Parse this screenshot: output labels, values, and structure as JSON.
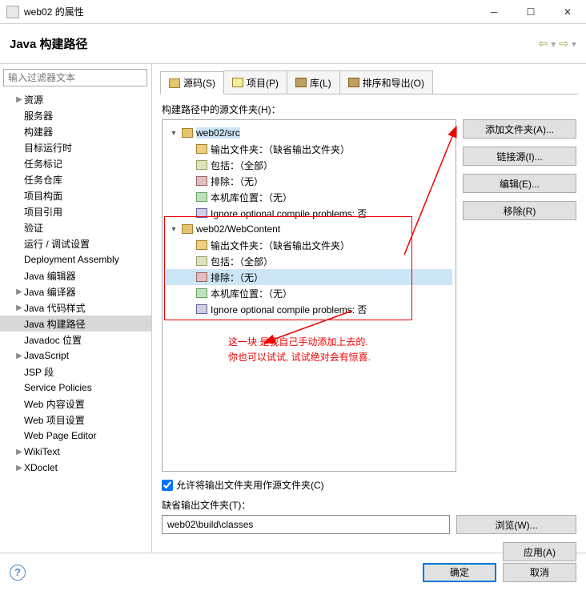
{
  "window": {
    "title": "web02 的属性"
  },
  "filter": {
    "placeholder": "输入过滤器文本"
  },
  "sidebar": {
    "items": [
      {
        "label": "资源",
        "expandable": true,
        "selected": false
      },
      {
        "label": "服务器",
        "expandable": false,
        "selected": false
      },
      {
        "label": "构建器",
        "expandable": false,
        "selected": false
      },
      {
        "label": "目标运行时",
        "expandable": false,
        "selected": false
      },
      {
        "label": "任务标记",
        "expandable": false,
        "selected": false
      },
      {
        "label": "任务仓库",
        "expandable": false,
        "selected": false
      },
      {
        "label": "项目构面",
        "expandable": false,
        "selected": false
      },
      {
        "label": "项目引用",
        "expandable": false,
        "selected": false
      },
      {
        "label": "验证",
        "expandable": false,
        "selected": false
      },
      {
        "label": "运行 / 调试设置",
        "expandable": false,
        "selected": false
      },
      {
        "label": "Deployment Assembly",
        "expandable": false,
        "selected": false
      },
      {
        "label": "Java 编辑器",
        "expandable": false,
        "selected": false
      },
      {
        "label": "Java 编译器",
        "expandable": true,
        "selected": false
      },
      {
        "label": "Java 代码样式",
        "expandable": true,
        "selected": false
      },
      {
        "label": "Java 构建路径",
        "expandable": false,
        "selected": true
      },
      {
        "label": "Javadoc 位置",
        "expandable": false,
        "selected": false
      },
      {
        "label": "JavaScript",
        "expandable": true,
        "selected": false
      },
      {
        "label": "JSP 段",
        "expandable": false,
        "selected": false
      },
      {
        "label": "Service Policies",
        "expandable": false,
        "selected": false
      },
      {
        "label": "Web 内容设置",
        "expandable": false,
        "selected": false
      },
      {
        "label": "Web 项目设置",
        "expandable": false,
        "selected": false
      },
      {
        "label": "Web Page Editor",
        "expandable": false,
        "selected": false
      },
      {
        "label": "WikiText",
        "expandable": true,
        "selected": false
      },
      {
        "label": "XDoclet",
        "expandable": true,
        "selected": false
      }
    ]
  },
  "page": {
    "heading": "Java 构建路径",
    "tabs": [
      {
        "label": "源码(S)",
        "iconClass": "ic-folder",
        "active": true
      },
      {
        "label": "项目(P)",
        "iconClass": "ic-proj",
        "active": false
      },
      {
        "label": "库(L)",
        "iconClass": "ic-lib",
        "active": false
      },
      {
        "label": "排序和导出(O)",
        "iconClass": "ic-order",
        "active": false
      }
    ],
    "sourceFoldersLabel": "构建路径中的源文件夹(H)：",
    "buttons": {
      "addFolder": "添加文件夹(A)...",
      "linkSource": "链接源(I)...",
      "edit": "编辑(E)...",
      "remove": "移除(R)"
    },
    "folders": [
      {
        "name": "web02/src",
        "children": [
          {
            "icon": "ic-out",
            "text": "输出文件夹：（缺省输出文件夹）"
          },
          {
            "icon": "ic-inc",
            "text": "包括：（全部）"
          },
          {
            "icon": "ic-exc",
            "text": "排除：（无）"
          },
          {
            "icon": "ic-nat",
            "text": "本机库位置：（无）"
          },
          {
            "icon": "ic-ign",
            "text": "Ignore optional compile problems: 否"
          }
        ]
      },
      {
        "name": "web02/WebContent",
        "children": [
          {
            "icon": "ic-out",
            "text": "输出文件夹：（缺省输出文件夹）"
          },
          {
            "icon": "ic-inc",
            "text": "包括：（全部）"
          },
          {
            "icon": "ic-exc",
            "text": "排除：（无）"
          },
          {
            "icon": "ic-nat",
            "text": "本机库位置：（无）"
          },
          {
            "icon": "ic-ign",
            "text": "Ignore optional compile problems: 否"
          }
        ]
      }
    ],
    "allowOutputCheckbox": "允许将输出文件夹用作源文件夹(C)",
    "defaultOutputLabel": "缺省输出文件夹(T)：",
    "defaultOutputValue": "web02\\build\\classes",
    "browse": "浏览(W)...",
    "apply": "应用(A)"
  },
  "annotation": {
    "line1": "这一块 是我自己手动添加上去的.",
    "line2": "你也可以试试, 试试绝对会有惊喜."
  },
  "footer": {
    "ok": "确定",
    "cancel": "取消"
  }
}
